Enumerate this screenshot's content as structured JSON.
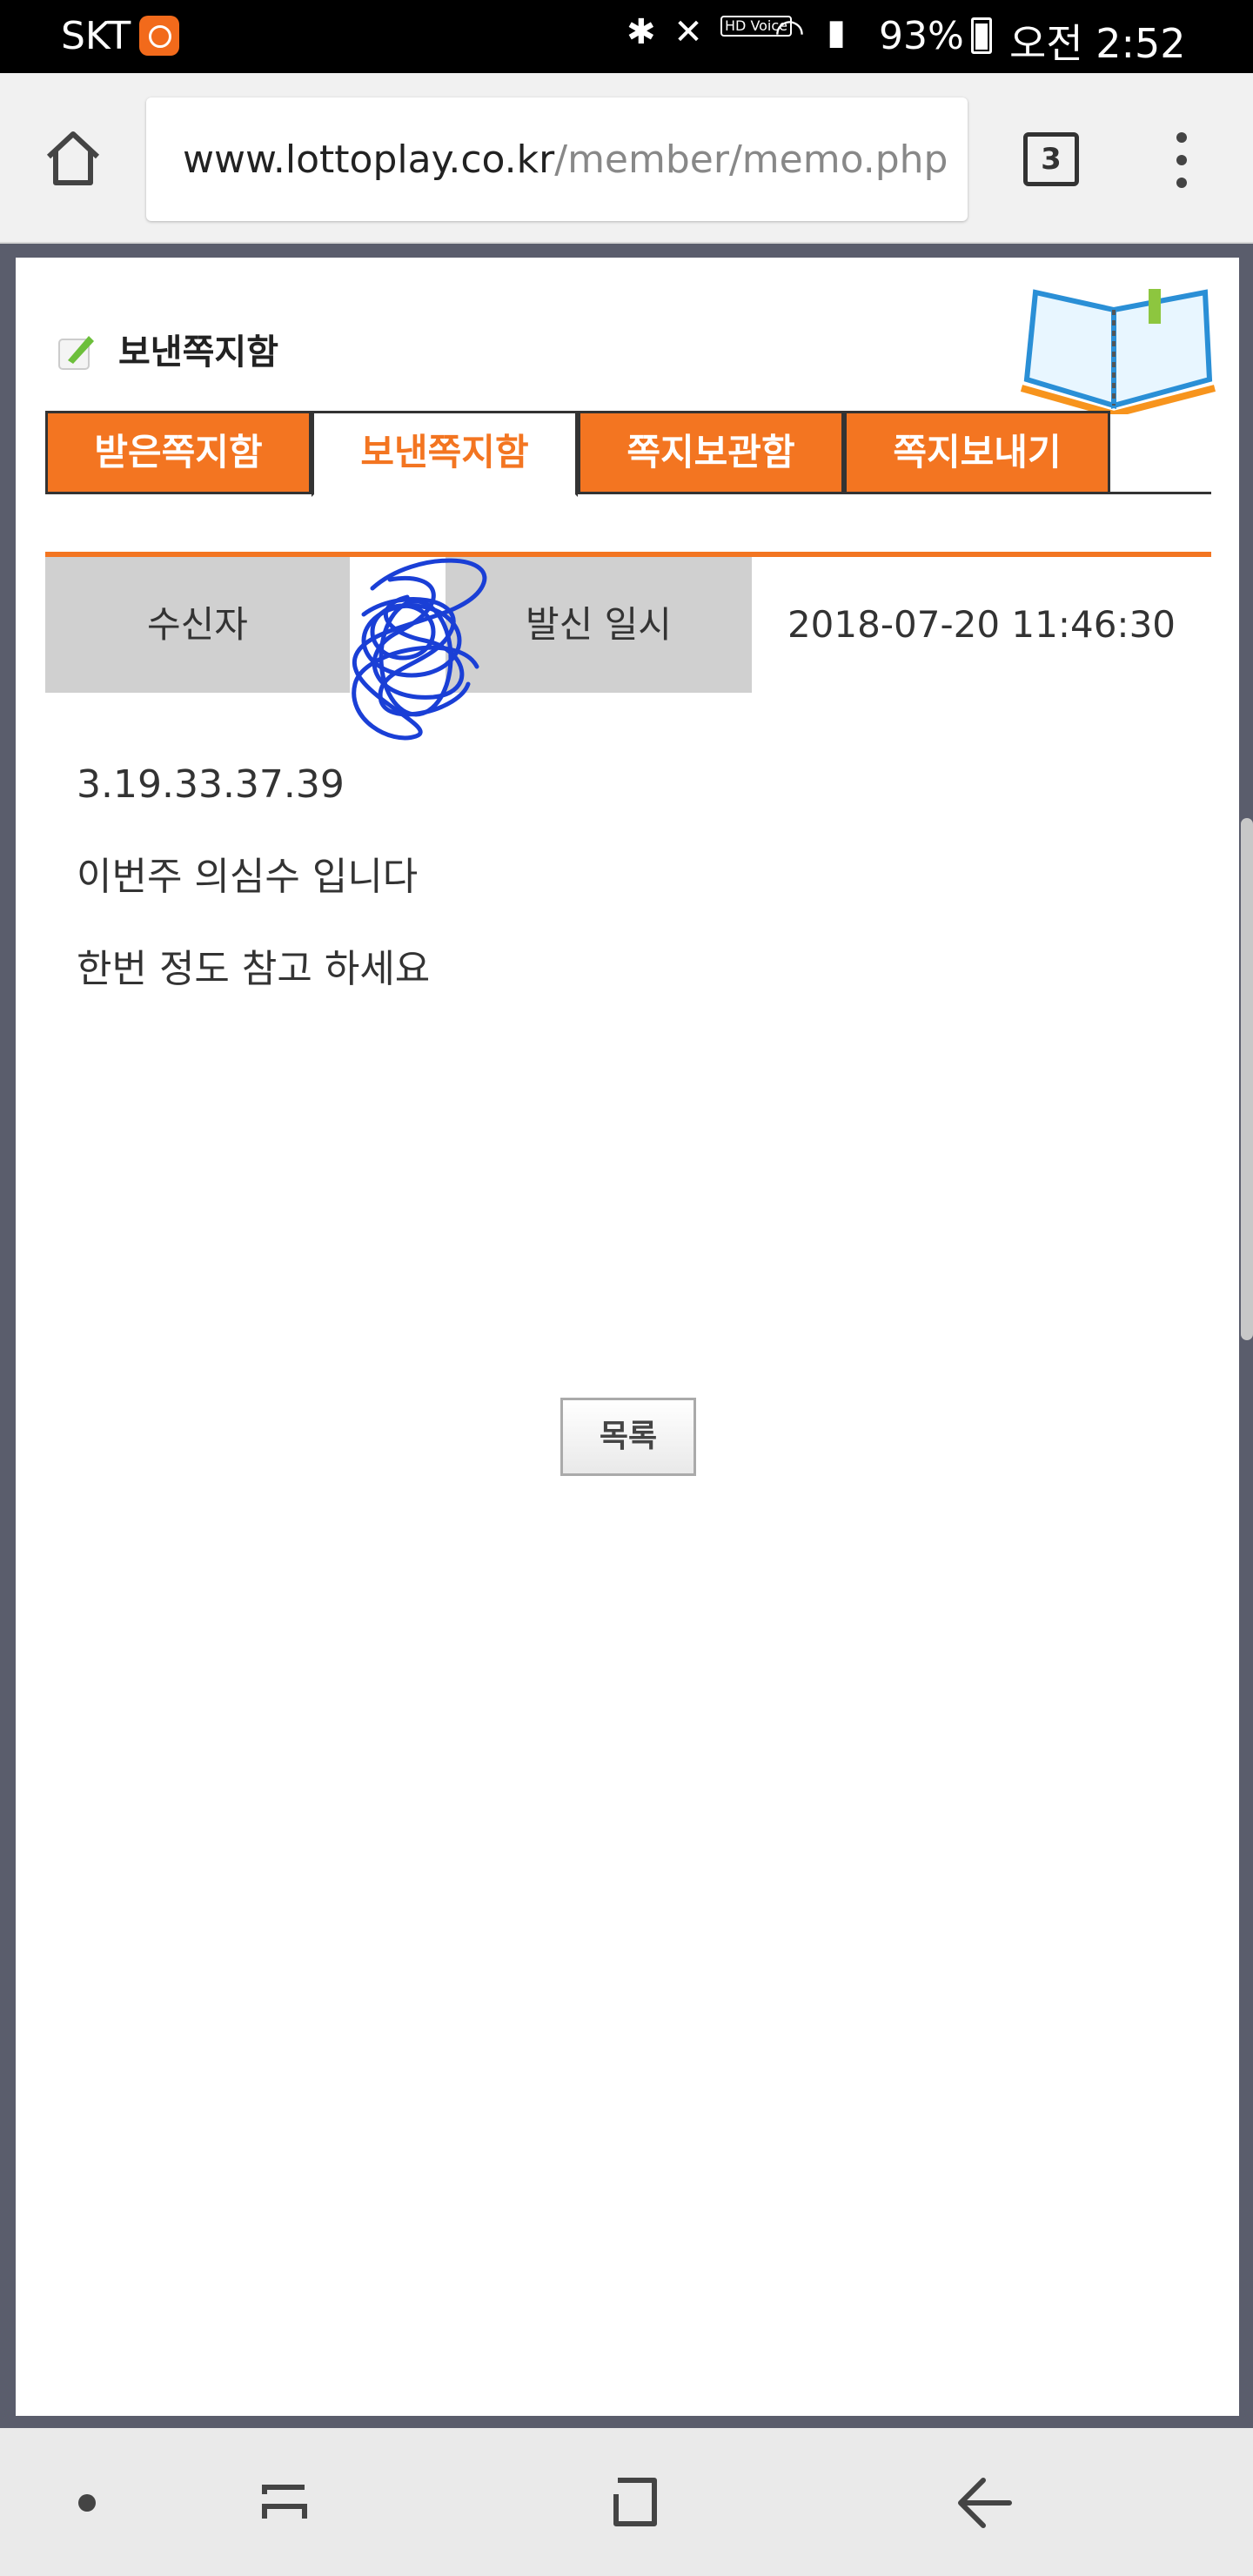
{
  "status_bar": {
    "carrier": "SKT",
    "indicators": [
      "bluetooth-icon",
      "mute-vibrate-icon",
      "hd-voice-icon",
      "wifi-icon",
      "signal-icon"
    ],
    "hd_label": "HD Voice",
    "battery": "93%",
    "time": "오전 2:52"
  },
  "browser": {
    "url_domain": "www.lottoplay.co.kr",
    "url_path": "/member/memo.php",
    "tab_count": "3"
  },
  "memo": {
    "title": "보낸쪽지함",
    "tabs": [
      {
        "label": "받은쪽지함"
      },
      {
        "label": "보낸쪽지함"
      },
      {
        "label": "쪽지보관함"
      },
      {
        "label": "쪽지보내기"
      }
    ],
    "active_tab": "보낸쪽지함",
    "detail": {
      "recipient_label": "수신자",
      "recipient_value": "",
      "sent_label": "발신 일시",
      "sent_value": "2018-07-20 11:46:30"
    },
    "message_lines": [
      "3.19.33.37.39",
      "이번주 의심수 입니다",
      "한번 정도 참고 하세요"
    ],
    "list_button": "목록"
  },
  "colors": {
    "accent": "#f37521",
    "cell_gray": "#d0d0d0",
    "scribble": "#1a3fd6"
  }
}
